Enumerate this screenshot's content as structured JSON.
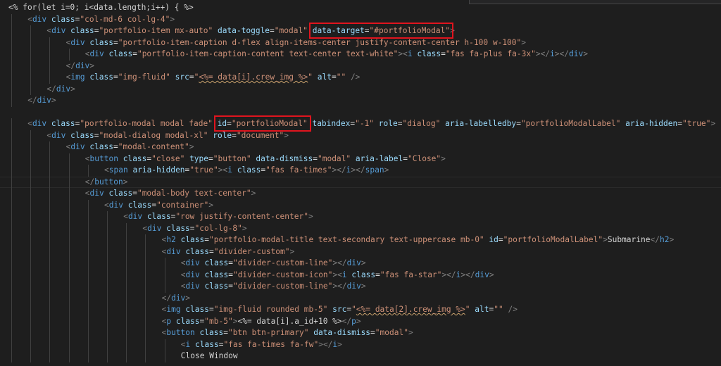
{
  "lines": [
    [
      [
        "t-plain",
        "<% for(let i=0; i<data.length;i++) { %>"
      ]
    ],
    [
      [
        "t-punc",
        "<"
      ],
      [
        "t-kw",
        "div"
      ],
      [
        "t-plain",
        " "
      ],
      [
        "t-attr",
        "class"
      ],
      [
        "t-plain",
        "="
      ],
      [
        "t-str",
        "\"col-md-6 col-lg-4\""
      ],
      [
        "t-punc",
        ">"
      ]
    ],
    [
      [
        "t-punc",
        "<"
      ],
      [
        "t-kw",
        "div"
      ],
      [
        "t-plain",
        " "
      ],
      [
        "t-attr",
        "class"
      ],
      [
        "t-plain",
        "="
      ],
      [
        "t-str",
        "\"portfolio-item mx-auto\""
      ],
      [
        "t-plain",
        " "
      ],
      [
        "t-attr",
        "data-toggle"
      ],
      [
        "t-plain",
        "="
      ],
      [
        "t-str",
        "\"modal\""
      ],
      [
        "t-plain",
        " "
      ],
      [
        "t-attr",
        "data-target"
      ],
      [
        "t-plain",
        "="
      ],
      [
        "t-str",
        "\"#portfolioModal\""
      ],
      [
        "t-punc",
        ">"
      ]
    ],
    [
      [
        "t-punc",
        "<"
      ],
      [
        "t-kw",
        "div"
      ],
      [
        "t-plain",
        " "
      ],
      [
        "t-attr",
        "class"
      ],
      [
        "t-plain",
        "="
      ],
      [
        "t-str",
        "\"portfolio-item-caption d-flex align-items-center justify-content-center h-100 w-100\""
      ],
      [
        "t-punc",
        ">"
      ]
    ],
    [
      [
        "t-punc",
        "<"
      ],
      [
        "t-kw",
        "div"
      ],
      [
        "t-plain",
        " "
      ],
      [
        "t-attr",
        "class"
      ],
      [
        "t-plain",
        "="
      ],
      [
        "t-str",
        "\"portfolio-item-caption-content text-center text-white\""
      ],
      [
        "t-punc",
        ">"
      ],
      [
        "t-punc",
        "<"
      ],
      [
        "t-kw",
        "i"
      ],
      [
        "t-plain",
        " "
      ],
      [
        "t-attr",
        "class"
      ],
      [
        "t-plain",
        "="
      ],
      [
        "t-str",
        "\"fas fa-plus fa-3x\""
      ],
      [
        "t-punc",
        "></"
      ],
      [
        "t-kw",
        "i"
      ],
      [
        "t-punc",
        "></"
      ],
      [
        "t-kw",
        "div"
      ],
      [
        "t-punc",
        ">"
      ]
    ],
    [
      [
        "t-punc",
        "</"
      ],
      [
        "t-kw",
        "div"
      ],
      [
        "t-punc",
        ">"
      ]
    ],
    [
      [
        "t-punc",
        "<"
      ],
      [
        "t-kw",
        "img"
      ],
      [
        "t-plain",
        " "
      ],
      [
        "t-attr",
        "class"
      ],
      [
        "t-plain",
        "="
      ],
      [
        "t-str",
        "\"img-fluid\""
      ],
      [
        "t-plain",
        " "
      ],
      [
        "t-attr",
        "src"
      ],
      [
        "t-plain",
        "="
      ],
      [
        "t-str",
        "\""
      ],
      [
        "t-squig",
        "<%= data[i].crew_img %>"
      ],
      [
        "t-str",
        "\""
      ],
      [
        "t-plain",
        " "
      ],
      [
        "t-attr",
        "alt"
      ],
      [
        "t-plain",
        "="
      ],
      [
        "t-str",
        "\"\""
      ],
      [
        "t-plain",
        " "
      ],
      [
        "t-punc",
        "/>"
      ]
    ],
    [
      [
        "t-punc",
        "</"
      ],
      [
        "t-kw",
        "div"
      ],
      [
        "t-punc",
        ">"
      ]
    ],
    [
      [
        "t-punc",
        "</"
      ],
      [
        "t-kw",
        "div"
      ],
      [
        "t-punc",
        ">"
      ]
    ],
    [],
    [
      [
        "t-punc",
        "<"
      ],
      [
        "t-kw",
        "div"
      ],
      [
        "t-plain",
        " "
      ],
      [
        "t-attr",
        "class"
      ],
      [
        "t-plain",
        "="
      ],
      [
        "t-str",
        "\"portfolio-modal modal fade\""
      ],
      [
        "t-plain",
        " "
      ],
      [
        "t-attr",
        "id"
      ],
      [
        "t-plain",
        "="
      ],
      [
        "t-str",
        "\"portfolioModal\""
      ],
      [
        "t-plain",
        " "
      ],
      [
        "t-attr",
        "tabindex"
      ],
      [
        "t-plain",
        "="
      ],
      [
        "t-str",
        "\"-1\""
      ],
      [
        "t-plain",
        " "
      ],
      [
        "t-attr",
        "role"
      ],
      [
        "t-plain",
        "="
      ],
      [
        "t-str",
        "\"dialog\""
      ],
      [
        "t-plain",
        " "
      ],
      [
        "t-attr",
        "aria-labelledby"
      ],
      [
        "t-plain",
        "="
      ],
      [
        "t-str",
        "\"portfolioModalLabel\""
      ],
      [
        "t-plain",
        " "
      ],
      [
        "t-attr",
        "aria-hidden"
      ],
      [
        "t-plain",
        "="
      ],
      [
        "t-str",
        "\"true\""
      ],
      [
        "t-punc",
        ">"
      ]
    ],
    [
      [
        "t-punc",
        "<"
      ],
      [
        "t-kw",
        "div"
      ],
      [
        "t-plain",
        " "
      ],
      [
        "t-attr",
        "class"
      ],
      [
        "t-plain",
        "="
      ],
      [
        "t-str",
        "\"modal-dialog modal-xl\""
      ],
      [
        "t-plain",
        " "
      ],
      [
        "t-attr",
        "role"
      ],
      [
        "t-plain",
        "="
      ],
      [
        "t-str",
        "\"document\""
      ],
      [
        "t-punc",
        ">"
      ]
    ],
    [
      [
        "t-punc",
        "<"
      ],
      [
        "t-kw",
        "div"
      ],
      [
        "t-plain",
        " "
      ],
      [
        "t-attr",
        "class"
      ],
      [
        "t-plain",
        "="
      ],
      [
        "t-str",
        "\"modal-content\""
      ],
      [
        "t-punc",
        ">"
      ]
    ],
    [
      [
        "t-punc",
        "<"
      ],
      [
        "t-kw",
        "button"
      ],
      [
        "t-plain",
        " "
      ],
      [
        "t-attr",
        "class"
      ],
      [
        "t-plain",
        "="
      ],
      [
        "t-str",
        "\"close\""
      ],
      [
        "t-plain",
        " "
      ],
      [
        "t-attr",
        "type"
      ],
      [
        "t-plain",
        "="
      ],
      [
        "t-str",
        "\"button\""
      ],
      [
        "t-plain",
        " "
      ],
      [
        "t-attr",
        "data-dismiss"
      ],
      [
        "t-plain",
        "="
      ],
      [
        "t-str",
        "\"modal\""
      ],
      [
        "t-plain",
        " "
      ],
      [
        "t-attr",
        "aria-label"
      ],
      [
        "t-plain",
        "="
      ],
      [
        "t-str",
        "\"Close\""
      ],
      [
        "t-punc",
        ">"
      ]
    ],
    [
      [
        "t-punc",
        "<"
      ],
      [
        "t-kw",
        "span"
      ],
      [
        "t-plain",
        " "
      ],
      [
        "t-attr",
        "aria-hidden"
      ],
      [
        "t-plain",
        "="
      ],
      [
        "t-str",
        "\"true\""
      ],
      [
        "t-punc",
        ">"
      ],
      [
        "t-punc",
        "<"
      ],
      [
        "t-kw",
        "i"
      ],
      [
        "t-plain",
        " "
      ],
      [
        "t-attr",
        "class"
      ],
      [
        "t-plain",
        "="
      ],
      [
        "t-str",
        "\"fas fa-times\""
      ],
      [
        "t-punc",
        "></"
      ],
      [
        "t-kw",
        "i"
      ],
      [
        "t-punc",
        "></"
      ],
      [
        "t-kw",
        "span"
      ],
      [
        "t-punc",
        ">"
      ]
    ],
    [
      [
        "t-punc",
        "</"
      ],
      [
        "t-kw",
        "button"
      ],
      [
        "t-punc",
        ">"
      ]
    ],
    [
      [
        "t-punc",
        "<"
      ],
      [
        "t-kw",
        "div"
      ],
      [
        "t-plain",
        " "
      ],
      [
        "t-attr",
        "class"
      ],
      [
        "t-plain",
        "="
      ],
      [
        "t-str",
        "\"modal-body text-center\""
      ],
      [
        "t-punc",
        ">"
      ]
    ],
    [
      [
        "t-punc",
        "<"
      ],
      [
        "t-kw",
        "div"
      ],
      [
        "t-plain",
        " "
      ],
      [
        "t-attr",
        "class"
      ],
      [
        "t-plain",
        "="
      ],
      [
        "t-str",
        "\"container\""
      ],
      [
        "t-punc",
        ">"
      ]
    ],
    [
      [
        "t-punc",
        "<"
      ],
      [
        "t-kw",
        "div"
      ],
      [
        "t-plain",
        " "
      ],
      [
        "t-attr",
        "class"
      ],
      [
        "t-plain",
        "="
      ],
      [
        "t-str",
        "\"row justify-content-center\""
      ],
      [
        "t-punc",
        ">"
      ]
    ],
    [
      [
        "t-punc",
        "<"
      ],
      [
        "t-kw",
        "div"
      ],
      [
        "t-plain",
        " "
      ],
      [
        "t-attr",
        "class"
      ],
      [
        "t-plain",
        "="
      ],
      [
        "t-str",
        "\"col-lg-8\""
      ],
      [
        "t-punc",
        ">"
      ]
    ],
    [
      [
        "t-punc",
        "<"
      ],
      [
        "t-kw",
        "h2"
      ],
      [
        "t-plain",
        " "
      ],
      [
        "t-attr",
        "class"
      ],
      [
        "t-plain",
        "="
      ],
      [
        "t-str",
        "\"portfolio-modal-title text-secondary text-uppercase mb-0\""
      ],
      [
        "t-plain",
        " "
      ],
      [
        "t-attr",
        "id"
      ],
      [
        "t-plain",
        "="
      ],
      [
        "t-str",
        "\"portfolioModalLabel\""
      ],
      [
        "t-punc",
        ">"
      ],
      [
        "t-plain",
        "Submarine"
      ],
      [
        "t-punc",
        "</"
      ],
      [
        "t-kw",
        "h2"
      ],
      [
        "t-punc",
        ">"
      ]
    ],
    [
      [
        "t-punc",
        "<"
      ],
      [
        "t-kw",
        "div"
      ],
      [
        "t-plain",
        " "
      ],
      [
        "t-attr",
        "class"
      ],
      [
        "t-plain",
        "="
      ],
      [
        "t-str",
        "\"divider-custom\""
      ],
      [
        "t-punc",
        ">"
      ]
    ],
    [
      [
        "t-punc",
        "<"
      ],
      [
        "t-kw",
        "div"
      ],
      [
        "t-plain",
        " "
      ],
      [
        "t-attr",
        "class"
      ],
      [
        "t-plain",
        "="
      ],
      [
        "t-str",
        "\"divider-custom-line\""
      ],
      [
        "t-punc",
        "></"
      ],
      [
        "t-kw",
        "div"
      ],
      [
        "t-punc",
        ">"
      ]
    ],
    [
      [
        "t-punc",
        "<"
      ],
      [
        "t-kw",
        "div"
      ],
      [
        "t-plain",
        " "
      ],
      [
        "t-attr",
        "class"
      ],
      [
        "t-plain",
        "="
      ],
      [
        "t-str",
        "\"divider-custom-icon\""
      ],
      [
        "t-punc",
        ">"
      ],
      [
        "t-punc",
        "<"
      ],
      [
        "t-kw",
        "i"
      ],
      [
        "t-plain",
        " "
      ],
      [
        "t-attr",
        "class"
      ],
      [
        "t-plain",
        "="
      ],
      [
        "t-str",
        "\"fas fa-star\""
      ],
      [
        "t-punc",
        "></"
      ],
      [
        "t-kw",
        "i"
      ],
      [
        "t-punc",
        "></"
      ],
      [
        "t-kw",
        "div"
      ],
      [
        "t-punc",
        ">"
      ]
    ],
    [
      [
        "t-punc",
        "<"
      ],
      [
        "t-kw",
        "div"
      ],
      [
        "t-plain",
        " "
      ],
      [
        "t-attr",
        "class"
      ],
      [
        "t-plain",
        "="
      ],
      [
        "t-str",
        "\"divider-custom-line\""
      ],
      [
        "t-punc",
        "></"
      ],
      [
        "t-kw",
        "div"
      ],
      [
        "t-punc",
        ">"
      ]
    ],
    [
      [
        "t-punc",
        "</"
      ],
      [
        "t-kw",
        "div"
      ],
      [
        "t-punc",
        ">"
      ]
    ],
    [
      [
        "t-punc",
        "<"
      ],
      [
        "t-kw",
        "img"
      ],
      [
        "t-plain",
        " "
      ],
      [
        "t-attr",
        "class"
      ],
      [
        "t-plain",
        "="
      ],
      [
        "t-str",
        "\"img-fluid rounded mb-5\""
      ],
      [
        "t-plain",
        " "
      ],
      [
        "t-attr",
        "src"
      ],
      [
        "t-plain",
        "="
      ],
      [
        "t-str",
        "\""
      ],
      [
        "t-squig",
        "<%= data[2].crew_img %>"
      ],
      [
        "t-str",
        "\""
      ],
      [
        "t-plain",
        " "
      ],
      [
        "t-attr",
        "alt"
      ],
      [
        "t-plain",
        "="
      ],
      [
        "t-str",
        "\"\""
      ],
      [
        "t-plain",
        " "
      ],
      [
        "t-punc",
        "/>"
      ]
    ],
    [
      [
        "t-punc",
        "<"
      ],
      [
        "t-kw",
        "p"
      ],
      [
        "t-plain",
        " "
      ],
      [
        "t-attr",
        "class"
      ],
      [
        "t-plain",
        "="
      ],
      [
        "t-str",
        "\"mb-5\""
      ],
      [
        "t-punc",
        ">"
      ],
      [
        "t-plain",
        "<%= data[i].a_id+10 %>"
      ],
      [
        "t-punc",
        "</"
      ],
      [
        "t-kw",
        "p"
      ],
      [
        "t-punc",
        ">"
      ]
    ],
    [
      [
        "t-punc",
        "<"
      ],
      [
        "t-kw",
        "button"
      ],
      [
        "t-plain",
        " "
      ],
      [
        "t-attr",
        "class"
      ],
      [
        "t-plain",
        "="
      ],
      [
        "t-str",
        "\"btn btn-primary\""
      ],
      [
        "t-plain",
        " "
      ],
      [
        "t-attr",
        "data-dismiss"
      ],
      [
        "t-plain",
        "="
      ],
      [
        "t-str",
        "\"modal\""
      ],
      [
        "t-punc",
        ">"
      ]
    ],
    [
      [
        "t-punc",
        "<"
      ],
      [
        "t-kw",
        "i"
      ],
      [
        "t-plain",
        " "
      ],
      [
        "t-attr",
        "class"
      ],
      [
        "t-plain",
        "="
      ],
      [
        "t-str",
        "\"fas fa-times fa-fw\""
      ],
      [
        "t-punc",
        "></"
      ],
      [
        "t-kw",
        "i"
      ],
      [
        "t-punc",
        ">"
      ]
    ],
    [
      [
        "t-plain",
        "Close Window"
      ]
    ]
  ],
  "indents": [
    0,
    1,
    2,
    3,
    4,
    3,
    3,
    2,
    1,
    0,
    1,
    2,
    3,
    4,
    5,
    4,
    4,
    5,
    6,
    7,
    8,
    8,
    9,
    9,
    9,
    8,
    8,
    8,
    8,
    9,
    9
  ],
  "highlighted": [
    "data-target=\"#portfolioModal\"",
    "id=\"portfolioModal\""
  ]
}
